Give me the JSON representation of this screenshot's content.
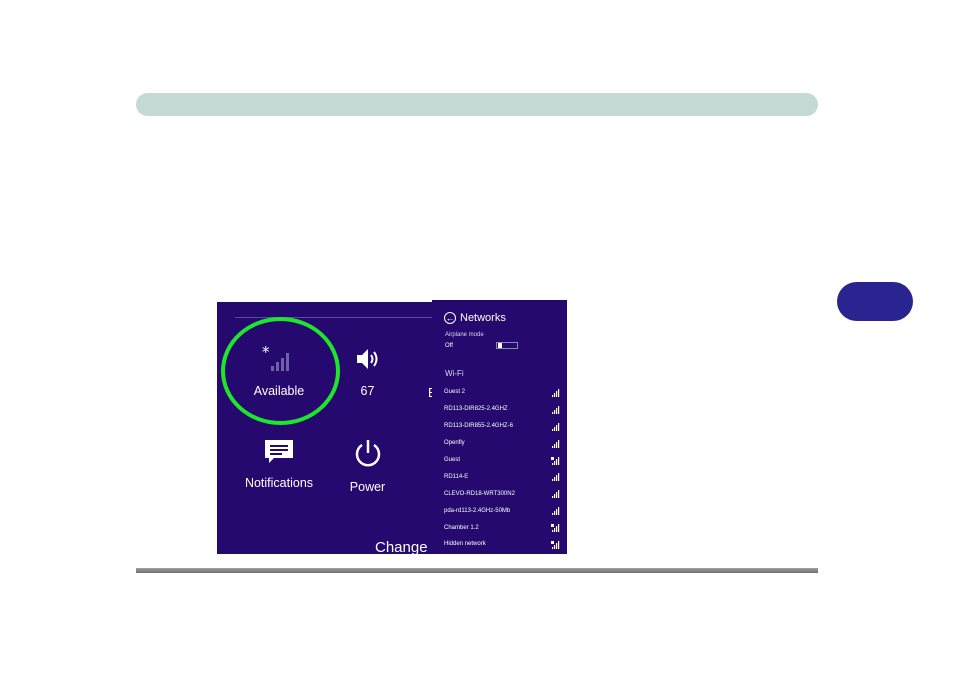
{
  "settings_panel": {
    "tiles": [
      {
        "label": "Available",
        "icon": "wifi-available-icon"
      },
      {
        "label": "67",
        "icon": "speaker-volume-icon"
      },
      {
        "label": "Notifications",
        "icon": "notifications-icon"
      },
      {
        "label": "Power",
        "icon": "power-icon"
      }
    ],
    "partial_tile_label": "B",
    "change_label": "Change |"
  },
  "networks": {
    "title": "Networks",
    "airplane_mode_label": "Airplane mode",
    "airplane_mode_state": "Off",
    "wifi_heading": "Wi-Fi",
    "items": [
      {
        "name": "Guest 2",
        "secured": false
      },
      {
        "name": "RD113-DIR825-2.4GHZ",
        "secured": false
      },
      {
        "name": "RD113-DIR855-2.4GHZ-6",
        "secured": false
      },
      {
        "name": "Openfly",
        "secured": false
      },
      {
        "name": "Guest",
        "secured": true
      },
      {
        "name": "RD114-E",
        "secured": false
      },
      {
        "name": "CLEVO-RD18-WRT300N2",
        "secured": false
      },
      {
        "name": "pda-rd113-2.4GHz-50Mb",
        "secured": false
      },
      {
        "name": "Chamber 1.2",
        "secured": true
      },
      {
        "name": "Hidden network",
        "secured": true
      }
    ]
  },
  "colors": {
    "panel_bg": "#26096e",
    "highlight": "#1ee62a",
    "header_bar": "#c5d9d6",
    "chapter_tab": "#2a2490"
  }
}
